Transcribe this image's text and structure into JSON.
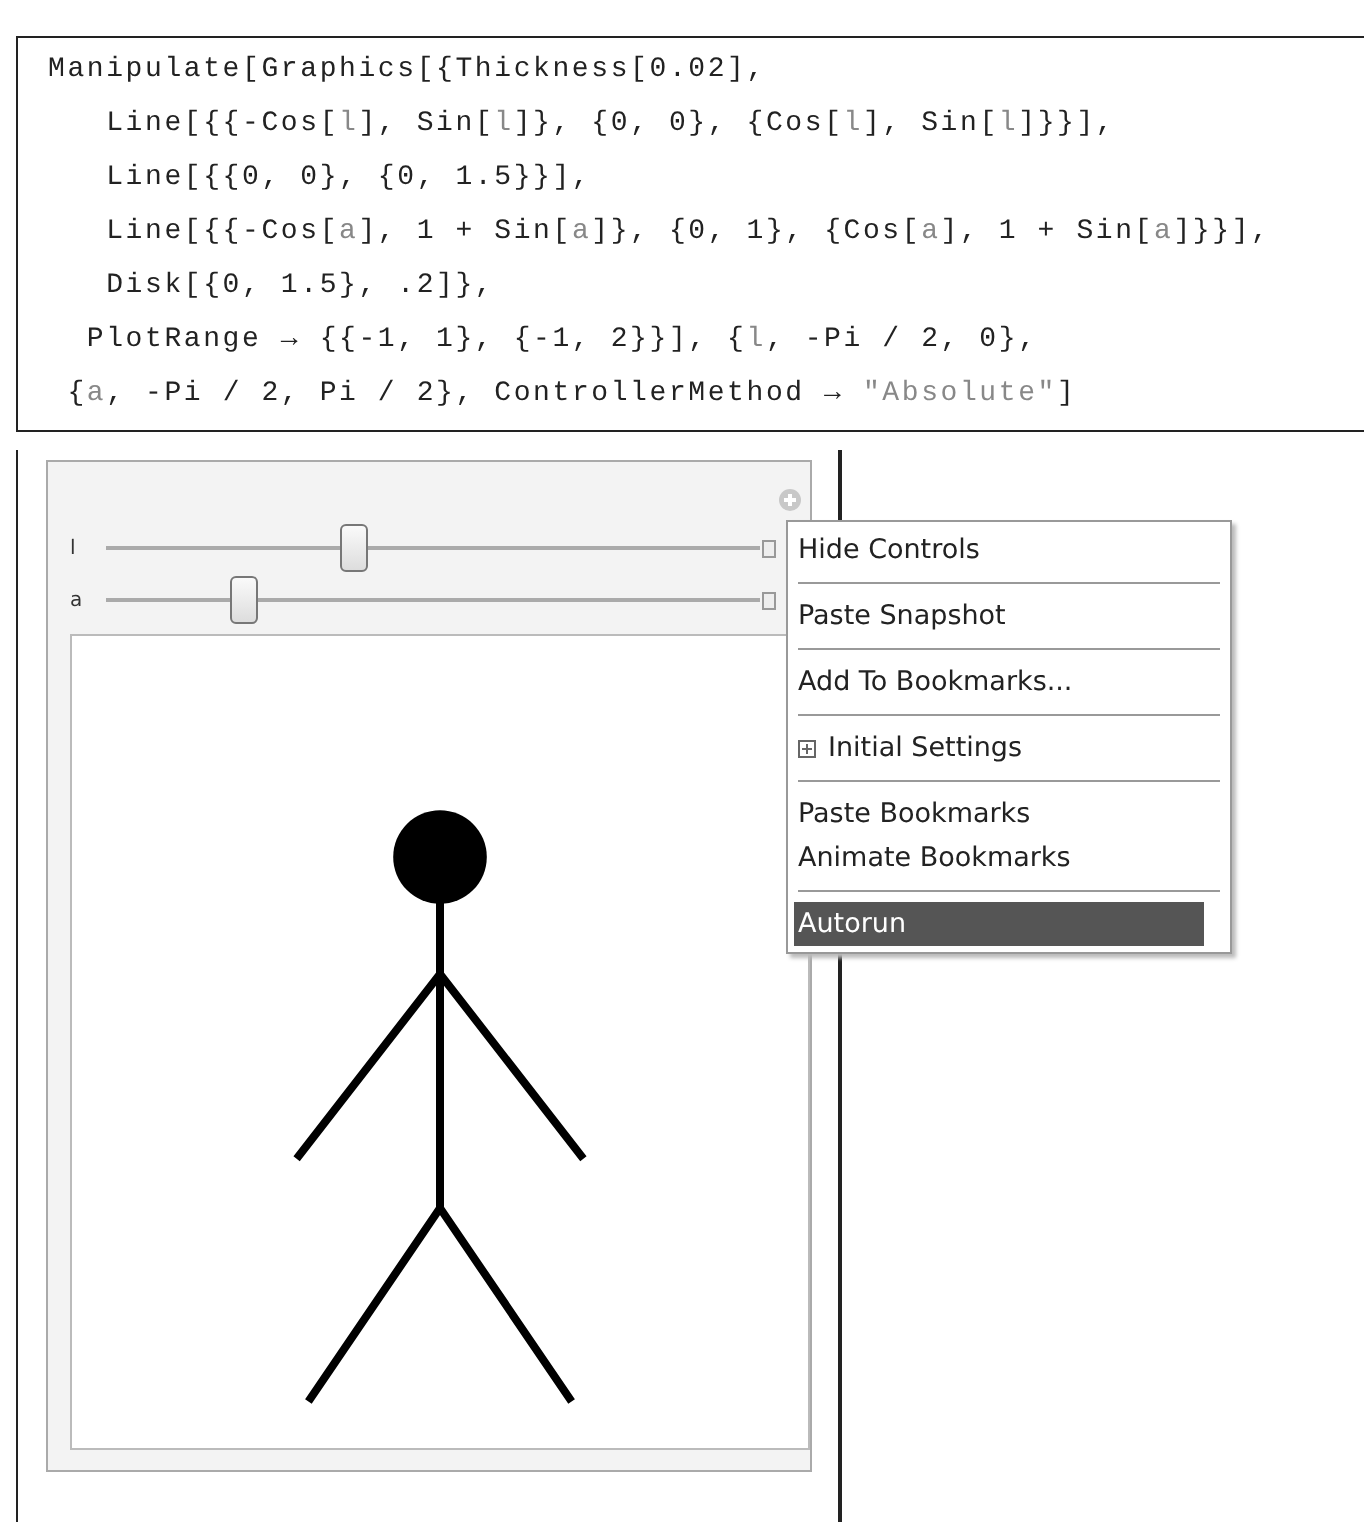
{
  "code_cell": {
    "lines": [
      [
        {
          "text": "Manipulate[Graphics[{Thickness[0.02],",
          "kind": "plain"
        }
      ],
      [
        {
          "text": "   Line[{{-Cos[",
          "kind": "plain"
        },
        {
          "text": "l",
          "kind": "variable"
        },
        {
          "text": "], Sin[",
          "kind": "plain"
        },
        {
          "text": "l",
          "kind": "variable"
        },
        {
          "text": "]}, {0, 0}, {Cos[",
          "kind": "plain"
        },
        {
          "text": "l",
          "kind": "variable"
        },
        {
          "text": "], Sin[",
          "kind": "plain"
        },
        {
          "text": "l",
          "kind": "variable"
        },
        {
          "text": "]}}],",
          "kind": "plain"
        }
      ],
      [
        {
          "text": "   Line[{{0, 0}, {0, 1.5}}],",
          "kind": "plain"
        }
      ],
      [
        {
          "text": "   Line[{{-Cos[",
          "kind": "plain"
        },
        {
          "text": "a",
          "kind": "variable"
        },
        {
          "text": "], 1 + Sin[",
          "kind": "plain"
        },
        {
          "text": "a",
          "kind": "variable"
        },
        {
          "text": "]}, {0, 1}, {Cos[",
          "kind": "plain"
        },
        {
          "text": "a",
          "kind": "variable"
        },
        {
          "text": "], 1 + Sin[",
          "kind": "plain"
        },
        {
          "text": "a",
          "kind": "variable"
        },
        {
          "text": "]}}],",
          "kind": "plain"
        }
      ],
      [
        {
          "text": "   Disk[{0, 1.5}, .2]},",
          "kind": "plain"
        }
      ],
      [
        {
          "text": "  PlotRange → {{-1, 1}, {-1, 2}}], {",
          "kind": "plain"
        },
        {
          "text": "l",
          "kind": "variable"
        },
        {
          "text": ", -Pi / 2, 0},",
          "kind": "plain"
        }
      ],
      [
        {
          "text": " {",
          "kind": "plain"
        },
        {
          "text": "a",
          "kind": "variable"
        },
        {
          "text": ", -Pi / 2, Pi / 2}, ControllerMethod → ",
          "kind": "plain"
        },
        {
          "text": "\"Absolute\"",
          "kind": "string"
        },
        {
          "text": "]",
          "kind": "plain"
        }
      ]
    ]
  },
  "manipulate": {
    "controls": [
      {
        "label": "l",
        "level": 0.38
      },
      {
        "label": "a",
        "level": 0.21
      }
    ],
    "context_menu": {
      "groups": [
        [
          {
            "label": "Hide Controls",
            "kind": "command",
            "selected": false
          }
        ],
        [
          {
            "label": "Paste Snapshot",
            "kind": "command",
            "selected": false
          }
        ],
        [
          {
            "label": "Add To Bookmarks...",
            "kind": "command",
            "selected": false
          }
        ],
        [
          {
            "label": "Initial Settings",
            "kind": "submenu",
            "selected": false
          }
        ],
        [
          {
            "label": "Paste Bookmarks",
            "kind": "command",
            "selected": false
          },
          {
            "label": "Animate Bookmarks",
            "kind": "command",
            "selected": false
          }
        ],
        [
          {
            "label": "Autorun",
            "kind": "command",
            "selected": true
          }
        ]
      ]
    }
  }
}
